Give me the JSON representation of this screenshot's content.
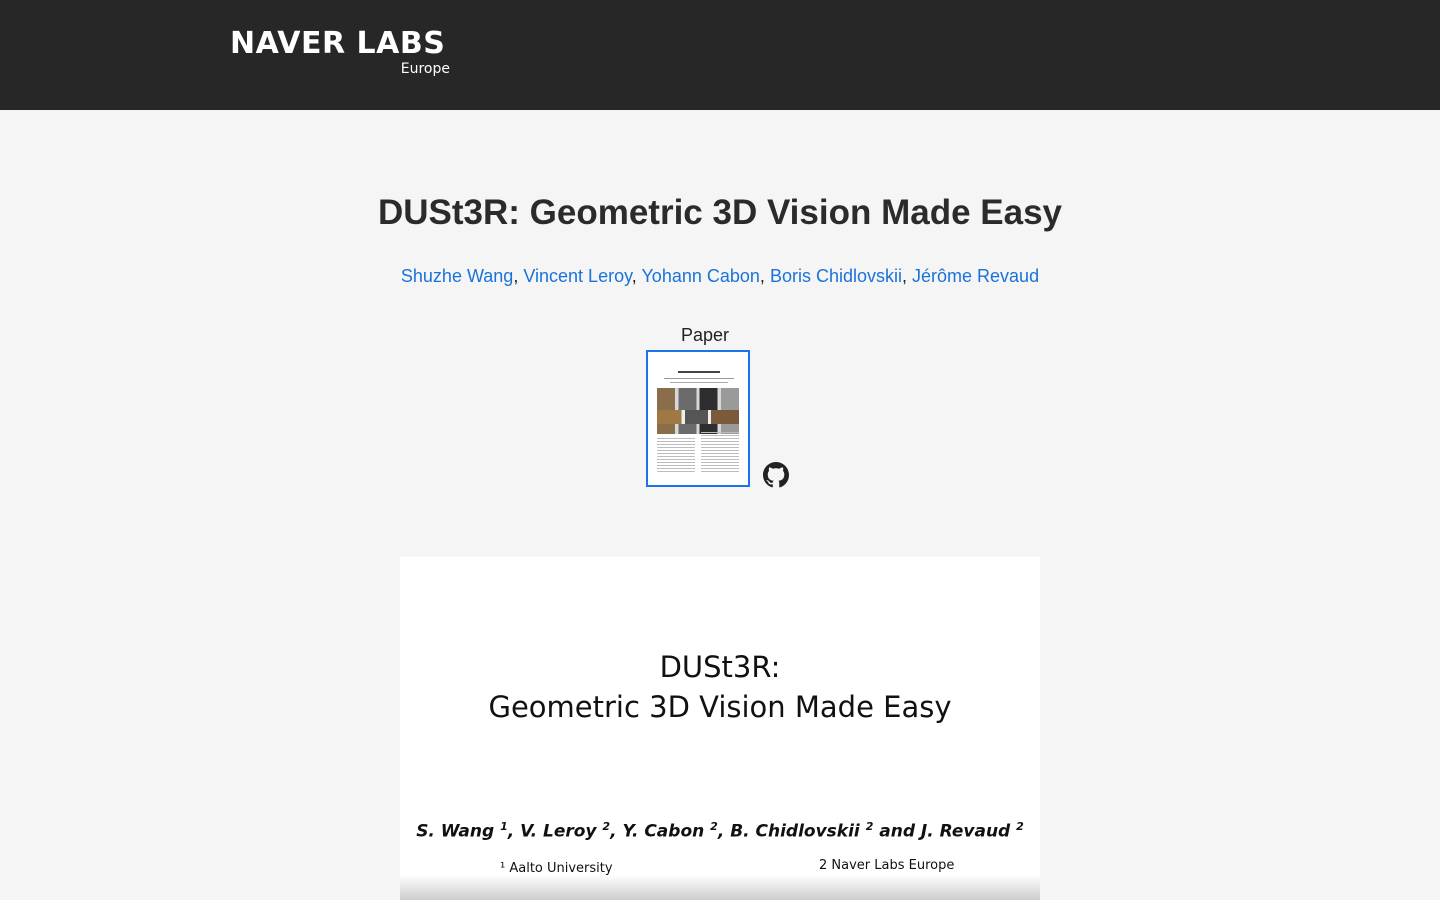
{
  "header": {
    "logo_main": "NAVER LABS",
    "logo_sub": "Europe"
  },
  "main": {
    "title": "DUSt3R: Geometric 3D Vision Made Easy",
    "authors": [
      {
        "name": "Shuzhe Wang"
      },
      {
        "name": "Vincent Leroy"
      },
      {
        "name": "Yohann Cabon"
      },
      {
        "name": "Boris Chidlovskii"
      },
      {
        "name": "Jérôme Revaud"
      }
    ],
    "author_separator": ",",
    "paper_label": "Paper",
    "github_icon": "github-icon"
  },
  "slide": {
    "title_line1": "DUSt3R:",
    "title_line2": "Geometric 3D Vision Made Easy",
    "authors_text_1": "S. Wang ",
    "sup_1": "1",
    "authors_text_2": ", V. Leroy ",
    "sup_2": "2",
    "authors_text_3": ", Y. Cabon ",
    "sup_3": "2",
    "authors_text_4": ", B. Chidlovskii ",
    "sup_4": "2",
    "authors_text_5": " and J. Revaud ",
    "sup_5": "2",
    "aff1": "¹ Aalto University",
    "aff2": "2 Naver Labs Europe"
  },
  "colors": {
    "header_bg": "#272727",
    "page_bg": "#f5f5f5",
    "link": "#1a73d9",
    "thumb_border": "#1a73e8"
  }
}
